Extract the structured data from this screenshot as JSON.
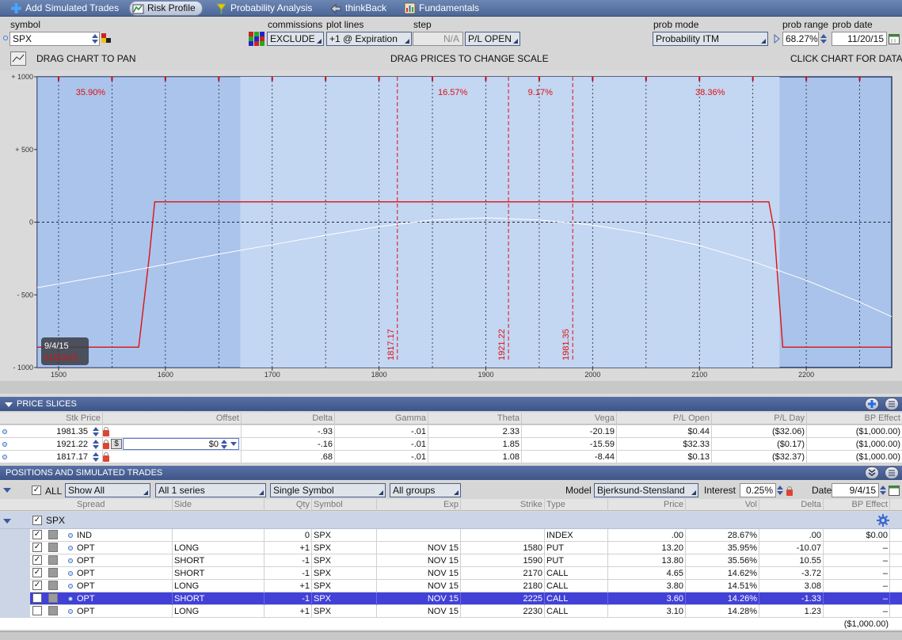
{
  "toolbar": {
    "items": [
      {
        "label": "Add Simulated Trades",
        "icon": "plus-icon"
      },
      {
        "label": "Risk Profile",
        "icon": "risk-profile-icon"
      },
      {
        "label": "Probability Analysis",
        "icon": "probability-icon"
      },
      {
        "label": "thinkBack",
        "icon": "thinkback-icon"
      },
      {
        "label": "Fundamentals",
        "icon": "fundamentals-icon"
      }
    ]
  },
  "controls": {
    "symbol_label": "symbol",
    "symbol_value": "SPX",
    "commissions_label": "commissions",
    "commissions_value": "EXCLUDE",
    "plot_lines_label": "plot lines",
    "plot_lines_value": "+1 @ Expiration",
    "step_label": "step",
    "step_value": "N/A",
    "pl_mode_value": "P/L OPEN",
    "prob_mode_label": "prob mode",
    "prob_mode_value": "Probability ITM",
    "prob_range_label": "prob range",
    "prob_range_value": "68.27%",
    "prob_date_label": "prob date",
    "prob_date_value": "11/20/15",
    "drag_pan": "DRAG CHART TO PAN",
    "drag_prices": "DRAG PRICES TO CHANGE SCALE",
    "click_chart": "CLICK CHART FOR DATA"
  },
  "chart_data": {
    "type": "line",
    "x_ticks": [
      "1500",
      "1600",
      "1700",
      "1800",
      "1900",
      "2000",
      "2100",
      "2200"
    ],
    "y_ticks": [
      "+ 1000",
      "+ 500",
      "0",
      "- 500",
      "- 1000"
    ],
    "xlim": [
      1480,
      2280
    ],
    "ylim": [
      -1000,
      1000
    ],
    "grid": true,
    "series": [
      {
        "name": "expiration",
        "color": "#e01010",
        "x": [
          1480,
          1575,
          1585,
          1590,
          2165,
          2170,
          2178,
          2280
        ],
        "y": [
          -860,
          -860,
          -230,
          140,
          140,
          -60,
          -860,
          -860
        ]
      },
      {
        "name": "today",
        "color": "#ffffff",
        "x": [
          1480,
          1550,
          1600,
          1650,
          1700,
          1750,
          1800,
          1850,
          1900,
          1950,
          2000,
          2050,
          2100,
          2150,
          2200,
          2250,
          2280
        ],
        "y": [
          -450,
          -360,
          -290,
          -220,
          -155,
          -90,
          -30,
          15,
          30,
          15,
          -20,
          -80,
          -160,
          -270,
          -400,
          -550,
          -650
        ]
      }
    ],
    "price_slices": [
      1817.17,
      1921.22,
      1981.35
    ],
    "probability_labels": [
      {
        "text": "35.90%",
        "x": 1530
      },
      {
        "text": "16.57%",
        "x": 1869
      },
      {
        "text": "9.17%",
        "x": 1951
      },
      {
        "text": "38.36%",
        "x": 2110
      }
    ],
    "prob_range": [
      1670,
      2175
    ],
    "date_labels": [
      "9/4/15",
      "11/20/15"
    ]
  },
  "colors": {
    "expiration_line": "#e01010",
    "today_line": "#ffffff",
    "chart_band": "#c3d6f2",
    "chart_outer": "#a9c3ea",
    "selected_row": "#4141d8"
  },
  "price_slices": {
    "title": "PRICE SLICES",
    "columns": [
      "Stk Price",
      "Offset",
      "Delta",
      "Gamma",
      "Theta",
      "Vega",
      "P/L Open",
      "P/L Day",
      "BP Effect"
    ],
    "rows": [
      {
        "stk": "1981.35",
        "offset": "",
        "delta": "-.93",
        "gamma": "-.01",
        "theta": "2.33",
        "vega": "-20.19",
        "pl_open": "$0.44",
        "pl_day": "($32.06)",
        "bp": "($1,000.00)"
      },
      {
        "stk": "1921.22",
        "offset": "$0",
        "delta": "-.16",
        "gamma": "-.01",
        "theta": "1.85",
        "vega": "-15.59",
        "pl_open": "$32.33",
        "pl_day": "($0.17)",
        "bp": "($1,000.00)"
      },
      {
        "stk": "1817.17",
        "offset": "",
        "delta": ".68",
        "gamma": "-.01",
        "theta": "1.08",
        "vega": "-8.44",
        "pl_open": "$0.13",
        "pl_day": "($32.37)",
        "bp": "($1,000.00)"
      }
    ],
    "dollar_badge": "$"
  },
  "positions": {
    "title": "POSITIONS AND SIMULATED TRADES",
    "all_label": "ALL",
    "show_value": "Show All",
    "series_value": "All 1 series",
    "symbol_mode_value": "Single Symbol",
    "groups_value": "All groups",
    "model_label": "Model",
    "model_value": "Bjerksund-Stensland",
    "interest_label": "Interest",
    "interest_value": "0.25%",
    "date_label": "Date",
    "date_value": "9/4/15",
    "columns": [
      "Spread",
      "Side",
      "Qty",
      "Symbol",
      "Exp",
      "Strike",
      "Type",
      "Price",
      "Vol",
      "Delta",
      "BP Effect"
    ],
    "group_label": "SPX",
    "rows": [
      {
        "checked": true,
        "spread": "IND",
        "side": "",
        "qty": "0",
        "symbol": "SPX",
        "exp": "",
        "strike": "",
        "type": "INDEX",
        "price": ".00",
        "vol": "28.67%",
        "delta": ".00",
        "bp": "$0.00"
      },
      {
        "checked": true,
        "spread": "OPT",
        "side": "LONG",
        "qty": "+1",
        "symbol": "SPX",
        "exp": "NOV 15",
        "strike": "1580",
        "type": "PUT",
        "price": "13.20",
        "vol": "35.95%",
        "delta": "-10.07",
        "bp": "–"
      },
      {
        "checked": true,
        "spread": "OPT",
        "side": "SHORT",
        "qty": "-1",
        "symbol": "SPX",
        "exp": "NOV 15",
        "strike": "1590",
        "type": "PUT",
        "price": "13.80",
        "vol": "35.56%",
        "delta": "10.55",
        "bp": "–"
      },
      {
        "checked": true,
        "spread": "OPT",
        "side": "SHORT",
        "qty": "-1",
        "symbol": "SPX",
        "exp": "NOV 15",
        "strike": "2170",
        "type": "CALL",
        "price": "4.65",
        "vol": "14.62%",
        "delta": "-3.72",
        "bp": "–"
      },
      {
        "checked": true,
        "spread": "OPT",
        "side": "LONG",
        "qty": "+1",
        "symbol": "SPX",
        "exp": "NOV 15",
        "strike": "2180",
        "type": "CALL",
        "price": "3.80",
        "vol": "14.51%",
        "delta": "3.08",
        "bp": "–"
      },
      {
        "checked": false,
        "spread": "OPT",
        "side": "SHORT",
        "qty": "-1",
        "symbol": "SPX",
        "exp": "NOV 15",
        "strike": "2225",
        "type": "CALL",
        "price": "3.60",
        "vol": "14.26%",
        "delta": "-1.33",
        "bp": "–"
      },
      {
        "checked": false,
        "spread": "OPT",
        "side": "LONG",
        "qty": "+1",
        "symbol": "SPX",
        "exp": "NOV 15",
        "strike": "2230",
        "type": "CALL",
        "price": "3.10",
        "vol": "14.28%",
        "delta": "1.23",
        "bp": "–"
      }
    ],
    "total_bp": "($1,000.00)"
  }
}
